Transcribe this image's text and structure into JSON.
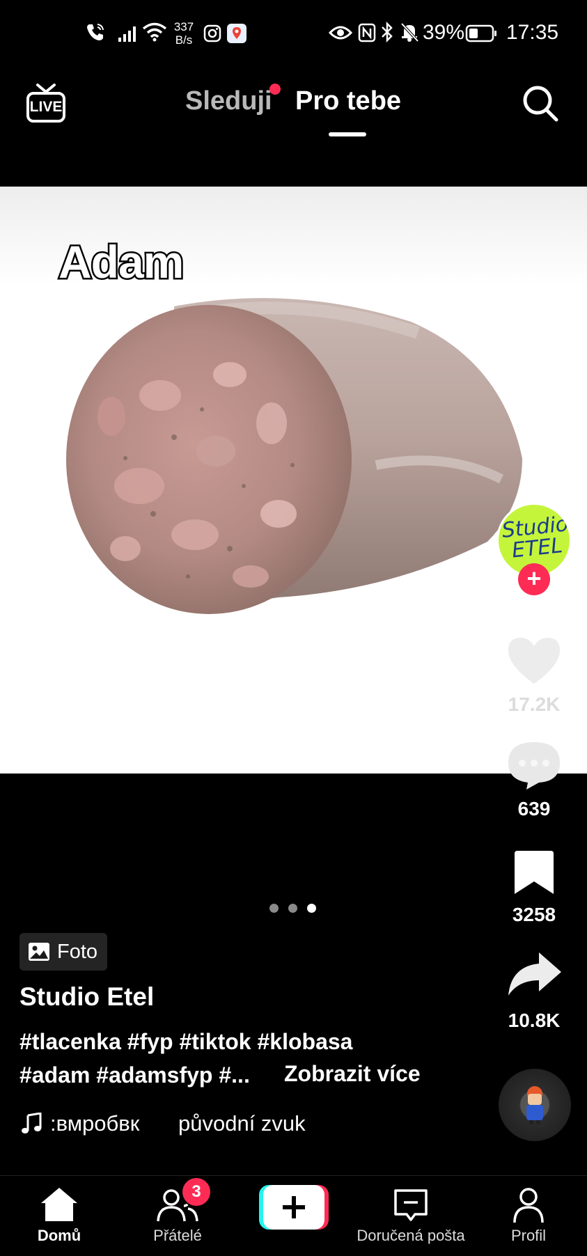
{
  "status_bar": {
    "net_speed_value": "337",
    "net_speed_unit": "B/s",
    "battery": "39%",
    "time": "17:35"
  },
  "top_nav": {
    "live_label": "LIVE",
    "tab_following": "Sleduji",
    "tab_for_you": "Pro tebe"
  },
  "post": {
    "image_caption": "Adam",
    "media_type_label": "Foto",
    "author": "Studio Etel",
    "hashtags_line1": "#tlacenka #fyp #tiktok #klobasa",
    "hashtags_line2": "#adam #adamsfyp  #...",
    "see_more": "Zobrazit více",
    "music_left": ":вмробвк",
    "music_right": "původní zvuk",
    "carousel": {
      "count": 3,
      "active_index": 3
    }
  },
  "creator_avatar_text": "Studio ETEL",
  "rail": {
    "likes": "17.2K",
    "comments": "639",
    "saves": "3258",
    "shares": "10.8K"
  },
  "bottom_nav": {
    "home": "Domů",
    "friends": "Přátelé",
    "friends_badge": "3",
    "inbox": "Doručená pošta",
    "profile": "Profil"
  },
  "colors": {
    "accent": "#fe2c55",
    "avatar_bg": "#c4f53a",
    "create_cyan": "#25f4ee"
  }
}
